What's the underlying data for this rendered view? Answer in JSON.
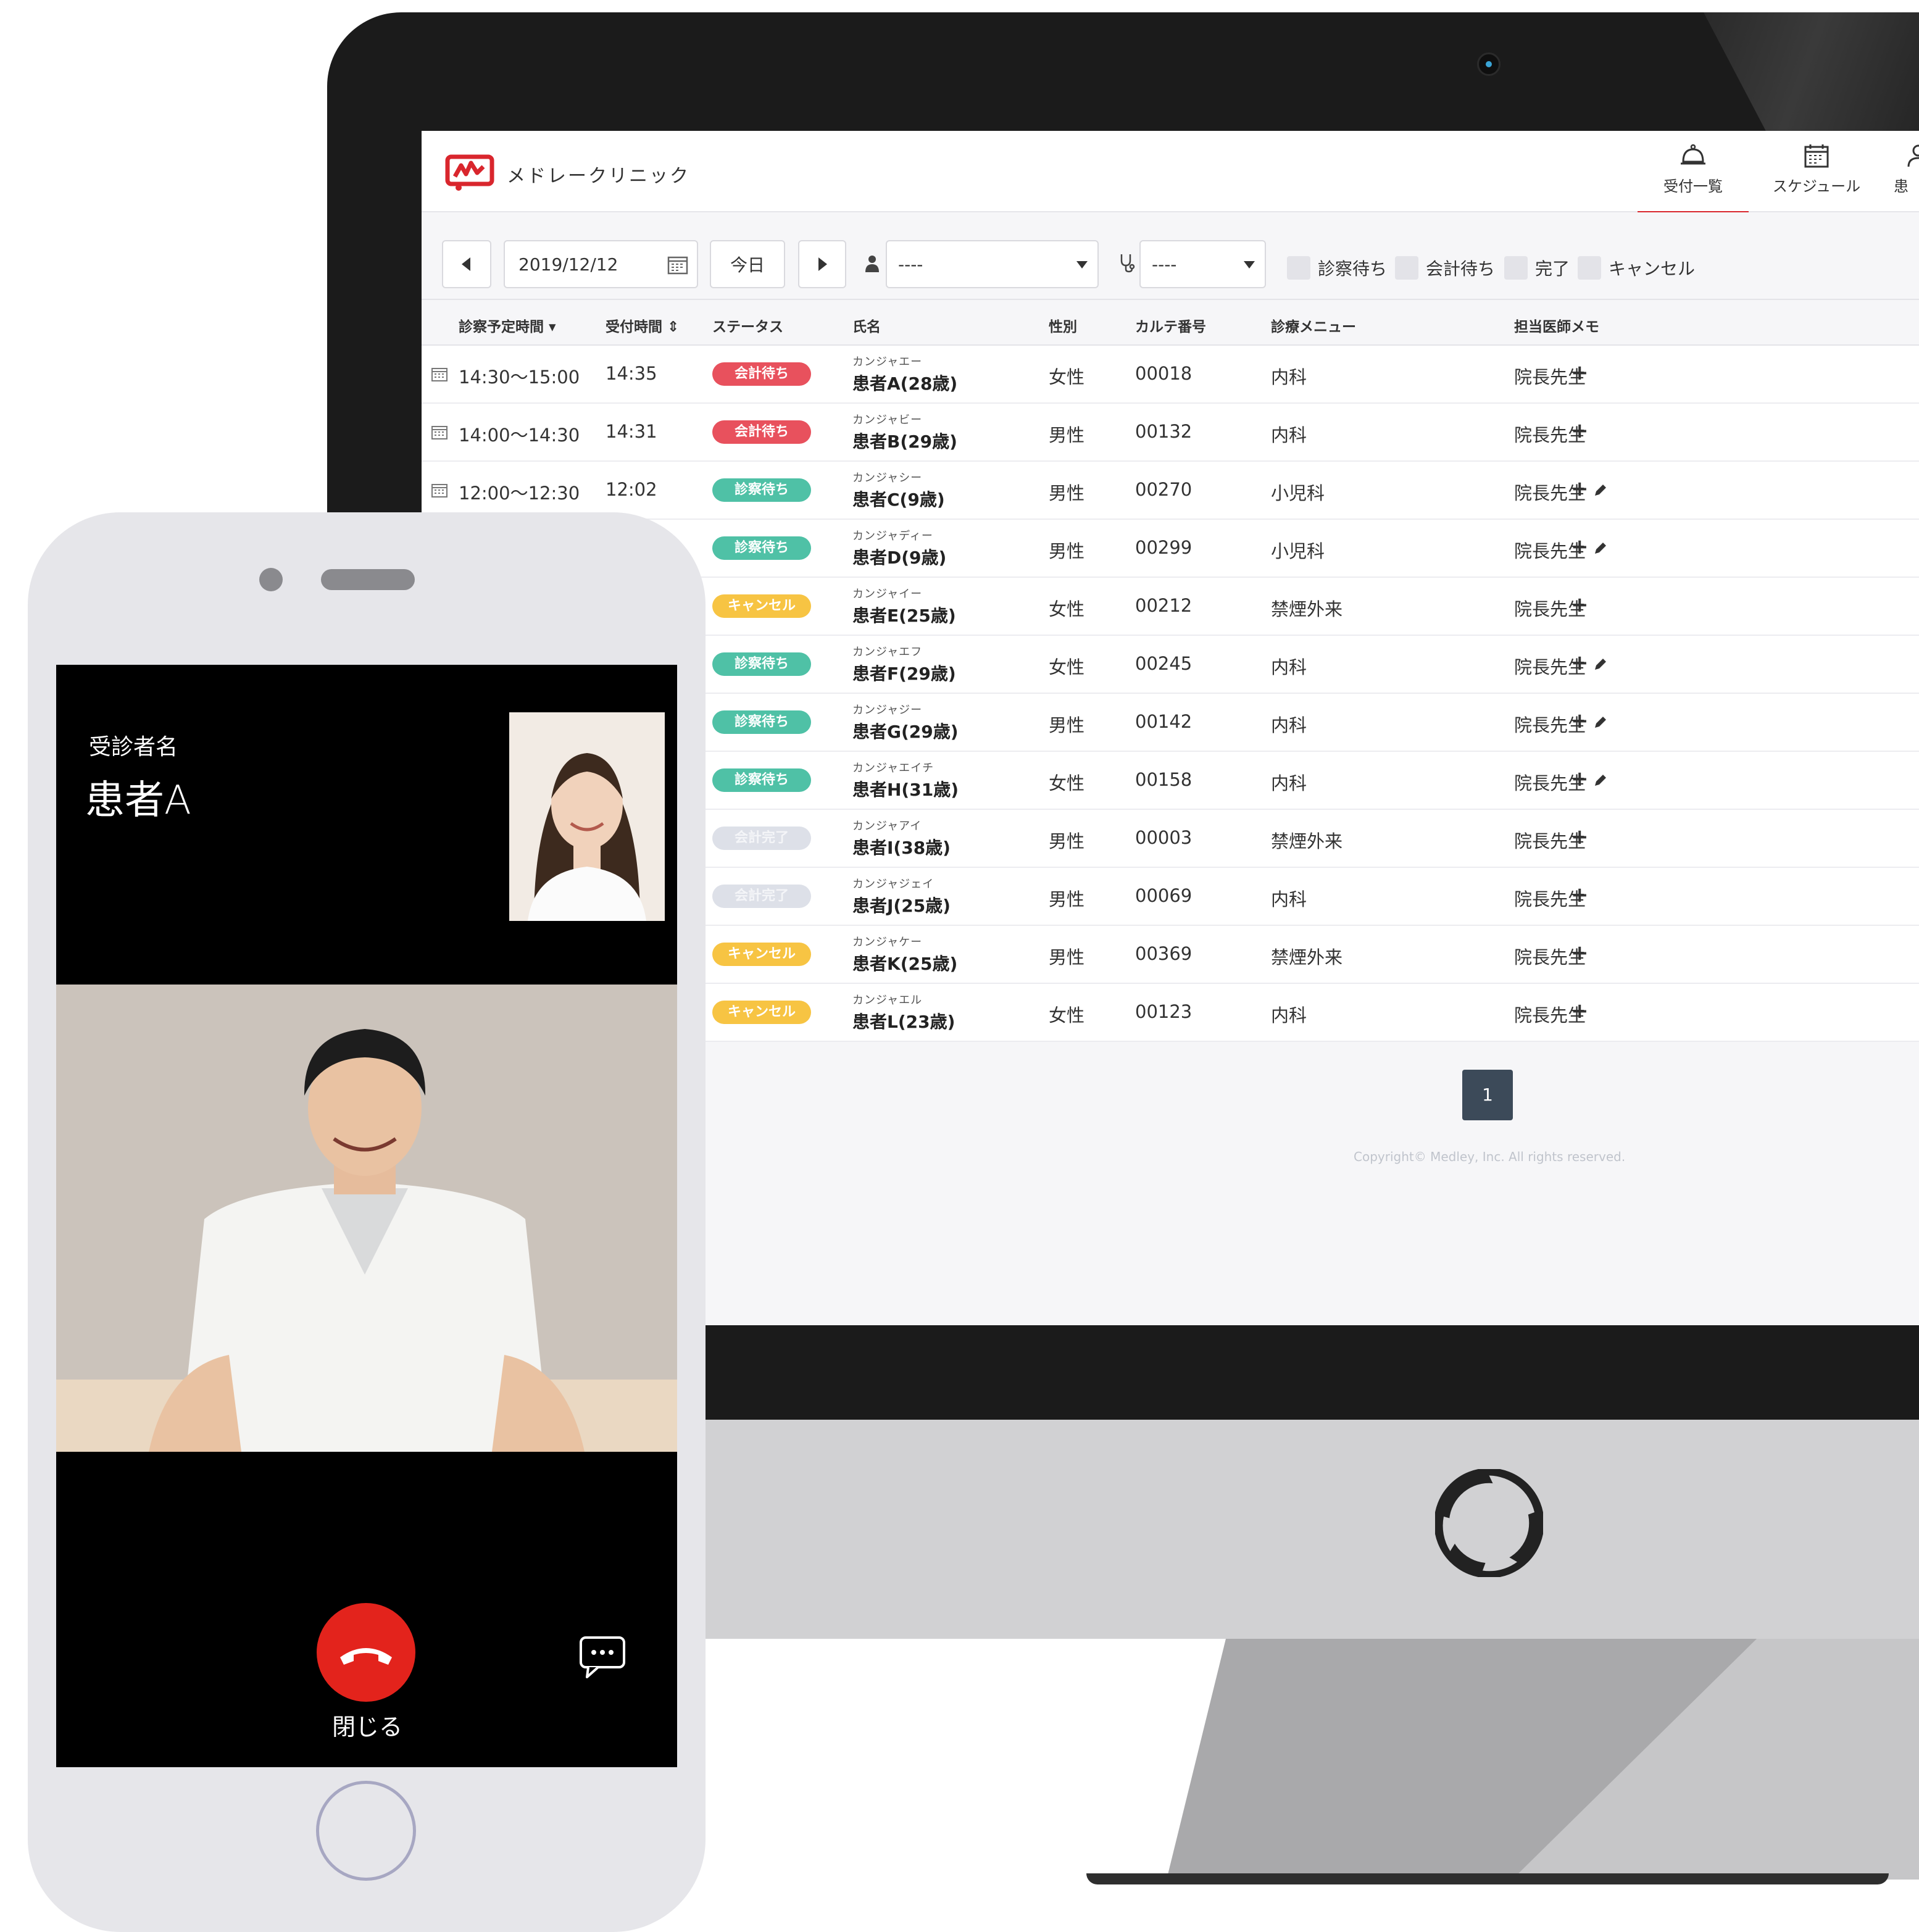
{
  "clinic": {
    "name": "メドレークリニック"
  },
  "nav": [
    {
      "label": "受付一覧",
      "icon": "bell-icon",
      "active": true
    },
    {
      "label": "スケジュール",
      "icon": "calendar-icon",
      "active": false
    },
    {
      "label": "患",
      "icon": "user-icon",
      "active": false
    }
  ],
  "filters": {
    "date": "2019/12/12",
    "today": "今日",
    "doctor_select": "----",
    "department_select": "----",
    "checkboxes": [
      "診察待ち",
      "会計待ち",
      "完了",
      "キャンセル"
    ]
  },
  "columns": [
    "診察予定時間",
    "受付時間",
    "ステータス",
    "氏名",
    "性別",
    "カルテ番号",
    "診療メニュー",
    "担当医師",
    "メモ"
  ],
  "status_colors": {
    "会計待ち": "#e8515d",
    "診察待ち": "#4fc1a6",
    "キャンセル": "#f7c443",
    "会計完了": "#dde0e8"
  },
  "rows": [
    {
      "scheduled": "14:30〜15:00",
      "received": "14:35",
      "status": "会計待ち",
      "kana": "カンジャエー",
      "name": "患者A(28歳)",
      "gender": "女性",
      "chart": "00018",
      "menu": "内科",
      "doctor": "院長先生",
      "edited": false
    },
    {
      "scheduled": "14:00〜14:30",
      "received": "14:31",
      "status": "会計待ち",
      "kana": "カンジャビー",
      "name": "患者B(29歳)",
      "gender": "男性",
      "chart": "00132",
      "menu": "内科",
      "doctor": "院長先生",
      "edited": false
    },
    {
      "scheduled": "12:00〜12:30",
      "received": "12:02",
      "status": "診察待ち",
      "kana": "カンジャシー",
      "name": "患者C(9歳)",
      "gender": "男性",
      "chart": "00270",
      "menu": "小児科",
      "doctor": "院長先生",
      "edited": true
    },
    {
      "scheduled": "",
      "received": "",
      "status": "診察待ち",
      "kana": "カンジャディー",
      "name": "患者D(9歳)",
      "gender": "男性",
      "chart": "00299",
      "menu": "小児科",
      "doctor": "院長先生",
      "edited": true
    },
    {
      "scheduled": "",
      "received": "",
      "status": "キャンセル",
      "kana": "カンジャイー",
      "name": "患者E(25歳)",
      "gender": "女性",
      "chart": "00212",
      "menu": "禁煙外来",
      "doctor": "院長先生",
      "edited": false
    },
    {
      "scheduled": "",
      "received": "",
      "status": "診察待ち",
      "kana": "カンジャエフ",
      "name": "患者F(29歳)",
      "gender": "女性",
      "chart": "00245",
      "menu": "内科",
      "doctor": "院長先生",
      "edited": true
    },
    {
      "scheduled": "",
      "received": "",
      "status": "診察待ち",
      "kana": "カンジャジー",
      "name": "患者G(29歳)",
      "gender": "男性",
      "chart": "00142",
      "menu": "内科",
      "doctor": "院長先生",
      "edited": true
    },
    {
      "scheduled": "",
      "received": "",
      "status": "診察待ち",
      "kana": "カンジャエイチ",
      "name": "患者H(31歳)",
      "gender": "女性",
      "chart": "00158",
      "menu": "内科",
      "doctor": "院長先生",
      "edited": true
    },
    {
      "scheduled": "",
      "received": "",
      "status": "会計完了",
      "kana": "カンジャアイ",
      "name": "患者I(38歳)",
      "gender": "男性",
      "chart": "00003",
      "menu": "禁煙外来",
      "doctor": "院長先生",
      "edited": false
    },
    {
      "scheduled": "",
      "received": "",
      "status": "会計完了",
      "kana": "カンジャジェイ",
      "name": "患者J(25歳)",
      "gender": "男性",
      "chart": "00069",
      "menu": "内科",
      "doctor": "院長先生",
      "edited": false
    },
    {
      "scheduled": "",
      "received": "",
      "status": "キャンセル",
      "kana": "カンジャケー",
      "name": "患者K(25歳)",
      "gender": "男性",
      "chart": "00369",
      "menu": "禁煙外来",
      "doctor": "院長先生",
      "edited": false
    },
    {
      "scheduled": "",
      "received": "",
      "status": "キャンセル",
      "kana": "カンジャエル",
      "name": "患者L(23歳)",
      "gender": "女性",
      "chart": "00123",
      "menu": "内科",
      "doctor": "院長先生",
      "edited": false
    }
  ],
  "memo_add": "+",
  "pagination": {
    "current": "1"
  },
  "copyright": "Copyright© Medley, Inc. All rights reserved.",
  "phone": {
    "patient_label": "受診者名",
    "patient_name": "患者A",
    "end_call_label": "閉じる"
  }
}
